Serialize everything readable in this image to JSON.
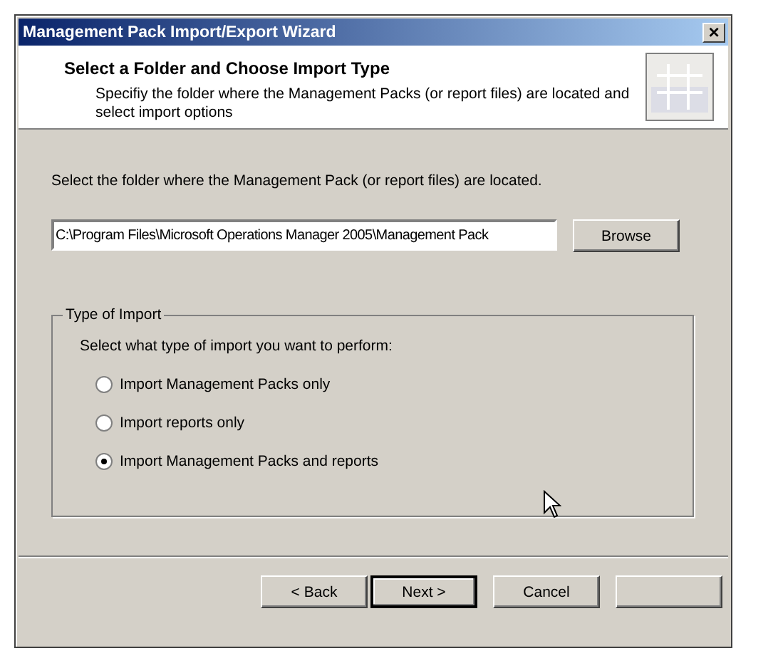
{
  "window": {
    "title": "Management Pack Import/Export Wizard",
    "close": "×"
  },
  "header": {
    "title": "Select a Folder and Choose Import Type",
    "subtitle": "Specifiy the folder where the Management Packs (or report files) are located and select import options"
  },
  "folder": {
    "label": "Select the folder where the Management Pack (or report files) are located.",
    "value": "C:\\Program Files\\Microsoft Operations Manager 2005\\Management Pack",
    "browse": "Browse"
  },
  "import_type": {
    "legend": "Type of Import",
    "prompt": "Select what type of import you want to perform:",
    "options": [
      {
        "label": "Import Management Packs only",
        "selected": false
      },
      {
        "label": "Import reports only",
        "selected": false
      },
      {
        "label": "Import Management Packs and reports",
        "selected": true
      }
    ]
  },
  "buttons": [
    {
      "label": "< Back",
      "default": false
    },
    {
      "label": "Next >",
      "default": true
    },
    {
      "label": "Cancel",
      "default": false
    }
  ]
}
